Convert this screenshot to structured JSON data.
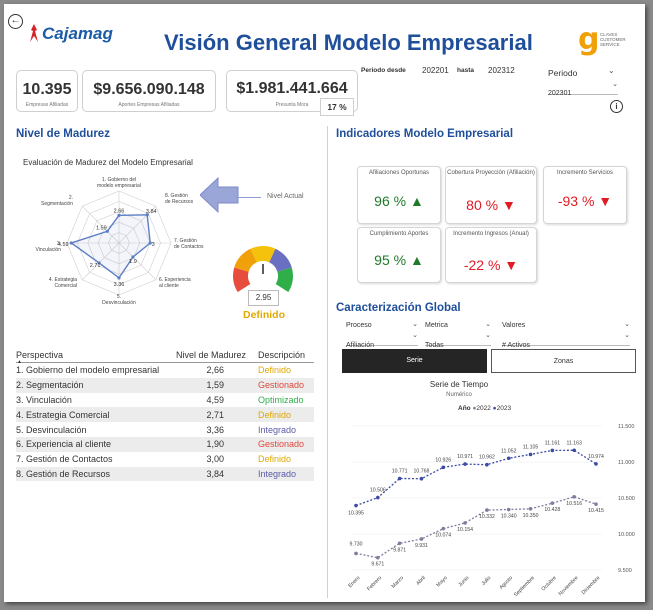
{
  "header": {
    "back_glyph": "←",
    "logo_text": "Cajamag",
    "title": "Visión General Modelo Empresarial",
    "brand_text": "CLAVES CUSTOMER SERVICE"
  },
  "kpis": [
    {
      "value": "10.395",
      "label": "Empresas Afiliadas"
    },
    {
      "value": "$9.656.090.148",
      "label": "Aportes Empresas Afiliadas"
    },
    {
      "value": "$1.981.441.664",
      "label": "Presunta Mora",
      "badge": "17 %"
    }
  ],
  "period_range": {
    "desde_label": "Periodo desde",
    "desde_value": "202201",
    "hasta_label": "hasta",
    "hasta_value": "202312"
  },
  "periodo_filter": {
    "label": "Periodo",
    "value": "202301",
    "info_icon": "info-icon"
  },
  "madurez": {
    "section_title": "Nivel de Madurez",
    "chart_title": "Evaluación de Madurez del Modelo Empresarial",
    "legend_label": "Nivel Actual",
    "gauge_value": "2.95",
    "gauge_status": "Definido",
    "table": {
      "headers": [
        "Perspectiva",
        "Nivel de Madurez",
        "Descripción"
      ],
      "rows": [
        {
          "perspectiva": "1. Gobierno del modelo empresarial",
          "nivel": "2,66",
          "descripcion": "Definido",
          "color": "#e0a800"
        },
        {
          "perspectiva": "2. Segmentación",
          "nivel": "1,59",
          "descripcion": "Gestionado",
          "color": "#e0483b"
        },
        {
          "perspectiva": "3. Vinculación",
          "nivel": "4,59",
          "descripcion": "Optimizado",
          "color": "#2fae4a"
        },
        {
          "perspectiva": "4. Estrategia Comercial",
          "nivel": "2,71",
          "descripcion": "Definido",
          "color": "#e0a800"
        },
        {
          "perspectiva": "5. Desvinculación",
          "nivel": "3,36",
          "descripcion": "Integrado",
          "color": "#5a5aa8"
        },
        {
          "perspectiva": "6. Experiencia al cliente",
          "nivel": "1,90",
          "descripcion": "Gestionado",
          "color": "#e0483b"
        },
        {
          "perspectiva": "7. Gestión de Contactos",
          "nivel": "3,00",
          "descripcion": "Definido",
          "color": "#e0a800"
        },
        {
          "perspectiva": "8. Gestión de Recursos",
          "nivel": "3,84",
          "descripcion": "Integrado",
          "color": "#5a5aa8"
        }
      ]
    }
  },
  "indicadores": {
    "section_title": "Indicadores Modelo Empresarial",
    "cards": [
      {
        "title": "Afiliaciones Oportunas",
        "value": "96 %",
        "arrow": "▲",
        "color": "#1f7a2a"
      },
      {
        "title": "Cobertura Proyección (Afiliación)",
        "value": "80 %",
        "arrow": "▼",
        "color": "#e01b24"
      },
      {
        "title": "Incremento Servicios",
        "value": "-93 %",
        "arrow": "▼",
        "color": "#e01b24"
      },
      {
        "title": "Cumplimiento Aportes",
        "value": "95 %",
        "arrow": "▲",
        "color": "#1f7a2a"
      },
      {
        "title": "Incremento Ingresos (Anual)",
        "value": "-22 %",
        "arrow": "▼",
        "color": "#e01b24"
      }
    ]
  },
  "caracterizacion": {
    "section_title": "Caracterización Global",
    "filters": [
      {
        "label": "Proceso",
        "value": "Afiliación"
      },
      {
        "label": "Metrica",
        "value": "Todas"
      },
      {
        "label": "Valores",
        "value": "# Activos"
      }
    ],
    "buttons": {
      "serie": "Serie",
      "zonas": "Zonas"
    },
    "chart_subtitle": "Numérico",
    "legend_title": "Año",
    "legend_items": [
      "2022",
      "2023"
    ]
  },
  "chart_data": [
    {
      "type": "radar",
      "title": "Evaluación de Madurez del Modelo Empresarial",
      "categories": [
        "1. Gobierno del modelo empresarial",
        "8. Gestión de Recursos",
        "7. Gestión de Contactos",
        "6. Experiencia al cliente",
        "5. Desvinculación",
        "4. Estrategia Comercial",
        "3. Vinculación",
        "2. Segmentación"
      ],
      "series": [
        {
          "name": "Nivel Actual",
          "values": [
            2.66,
            3.84,
            3.0,
            1.9,
            3.36,
            2.71,
            4.59,
            1.59
          ]
        }
      ],
      "point_labels": [
        "2.66",
        "3.84",
        "3",
        "1.9",
        "3.36",
        "2.71",
        "4.59",
        "1.59"
      ],
      "rlim": [
        0,
        5
      ]
    },
    {
      "type": "line",
      "title": "Serie de Tiempo",
      "categories": [
        "Enero",
        "Febrero",
        "Marzo",
        "Abril",
        "Mayo",
        "Junio",
        "Julio",
        "Agosto",
        "Septiembre",
        "Octubre",
        "Noviembre",
        "Diciembre"
      ],
      "series": [
        {
          "name": "2022",
          "color": "#7d7d9e",
          "values": [
            9730,
            9671,
            9871,
            9931,
            10074,
            10154,
            10332,
            10340,
            10350,
            10428,
            10516,
            10415
          ]
        },
        {
          "name": "2023",
          "color": "#3b4aa6",
          "values": [
            10395,
            10506,
            10771,
            10768,
            10926,
            10971,
            10962,
            11052,
            11105,
            11161,
            11163,
            10974
          ]
        }
      ],
      "labels_2022": [
        "9.730",
        "9.671",
        "9.871",
        "9.931",
        "10.074",
        "10.154",
        "10.332",
        "10.340",
        "10.350",
        "10.428",
        "10.516",
        "10.415"
      ],
      "labels_2023": [
        "10.395",
        "10.506",
        "10.771",
        "10.768",
        "10.926",
        "10.971",
        "10.962",
        "11.052",
        "11.105",
        "11.161",
        "11.163",
        "10.974"
      ],
      "yticks": [
        "11.500",
        "11.000",
        "10.500",
        "10.000",
        "9.500"
      ],
      "ytick_values": [
        11500,
        11000,
        10500,
        10000,
        9500
      ],
      "ylim": [
        9500,
        11500
      ]
    }
  ]
}
